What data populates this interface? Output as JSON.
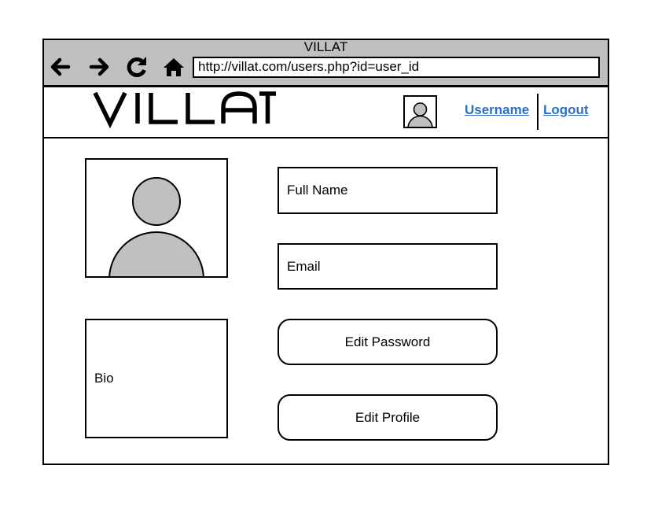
{
  "window": {
    "title": "VILLAT"
  },
  "toolbar": {
    "icons": [
      "back-arrow-icon",
      "forward-arrow-icon",
      "reload-icon",
      "home-icon"
    ],
    "url": "http://villat.com/users.php?id=user_id"
  },
  "header": {
    "logo_text": "VILLAT",
    "username_link": "Username",
    "logout_link": "Logout"
  },
  "profile": {
    "full_name_label": "Full Name",
    "email_label": "Email",
    "bio_label": "Bio",
    "edit_password_label": "Edit Password",
    "edit_profile_label": "Edit Profile"
  },
  "colors": {
    "chrome_bg": "#c0c0c0",
    "link": "#2f6ec4",
    "avatar_fill": "#c0c0c0"
  }
}
